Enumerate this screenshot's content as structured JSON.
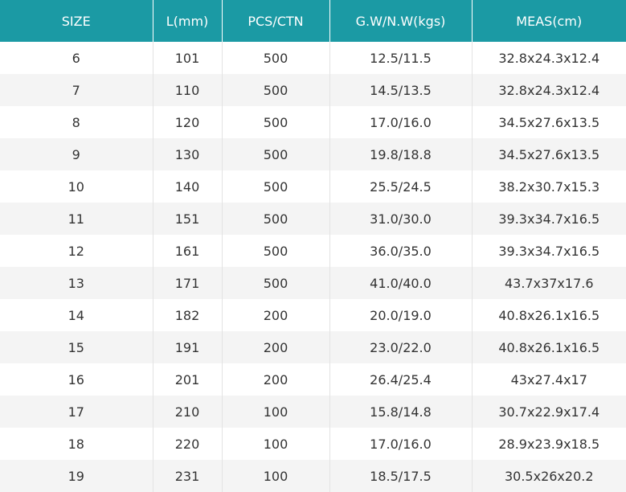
{
  "table": {
    "headers": [
      "SIZE",
      "L(mm)",
      "PCS/CTN",
      "G.W/N.W(kgs)",
      "MEAS(cm)"
    ],
    "rows": [
      [
        "6",
        "101",
        "500",
        "12.5/11.5",
        "32.8x24.3x12.4"
      ],
      [
        "7",
        "110",
        "500",
        "14.5/13.5",
        "32.8x24.3x12.4"
      ],
      [
        "8",
        "120",
        "500",
        "17.0/16.0",
        "34.5x27.6x13.5"
      ],
      [
        "9",
        "130",
        "500",
        "19.8/18.8",
        "34.5x27.6x13.5"
      ],
      [
        "10",
        "140",
        "500",
        "25.5/24.5",
        "38.2x30.7x15.3"
      ],
      [
        "11",
        "151",
        "500",
        "31.0/30.0",
        "39.3x34.7x16.5"
      ],
      [
        "12",
        "161",
        "500",
        "36.0/35.0",
        "39.3x34.7x16.5"
      ],
      [
        "13",
        "171",
        "500",
        "41.0/40.0",
        "43.7x37x17.6"
      ],
      [
        "14",
        "182",
        "200",
        "20.0/19.0",
        "40.8x26.1x16.5"
      ],
      [
        "15",
        "191",
        "200",
        "23.0/22.0",
        "40.8x26.1x16.5"
      ],
      [
        "16",
        "201",
        "200",
        "26.4/25.4",
        "43x27.4x17"
      ],
      [
        "17",
        "210",
        "100",
        "15.8/14.8",
        "30.7x22.9x17.4"
      ],
      [
        "18",
        "220",
        "100",
        "17.0/16.0",
        "28.9x23.9x18.5"
      ],
      [
        "19",
        "231",
        "100",
        "18.5/17.5",
        "30.5x26x20.2"
      ]
    ]
  },
  "colors": {
    "header_bg": "#1b9aa4",
    "header_text": "#ffffff",
    "stripe": "#f4f4f4",
    "cell_text": "#333333"
  }
}
